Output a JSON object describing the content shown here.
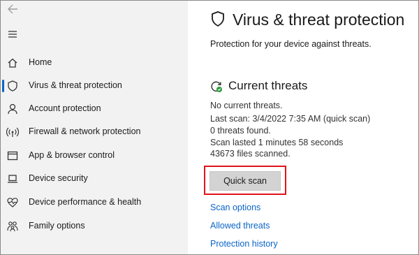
{
  "sidebar": {
    "items": [
      {
        "label": "Home",
        "icon": "home-icon"
      },
      {
        "label": "Virus & threat protection",
        "icon": "shield-icon",
        "active": true
      },
      {
        "label": "Account protection",
        "icon": "person-icon"
      },
      {
        "label": "Firewall & network protection",
        "icon": "wifi-icon"
      },
      {
        "label": "App & browser control",
        "icon": "app-window-icon"
      },
      {
        "label": "Device security",
        "icon": "laptop-icon"
      },
      {
        "label": "Device performance & health",
        "icon": "heart-icon"
      },
      {
        "label": "Family options",
        "icon": "family-icon"
      }
    ]
  },
  "main": {
    "title": "Virus & threat protection",
    "subtitle": "Protection for your device against threats.",
    "current_threats": {
      "heading": "Current threats",
      "status": "No current threats.",
      "last_scan": "Last scan: 3/4/2022 7:35 AM (quick scan)",
      "threats_found": "0 threats found.",
      "scan_duration": "Scan lasted 1 minutes 58 seconds",
      "files_scanned": "43673 files scanned."
    },
    "quick_scan_label": "Quick scan",
    "links": {
      "scan_options": "Scan options",
      "allowed_threats": "Allowed threats",
      "protection_history": "Protection history"
    }
  },
  "colors": {
    "accent": "#0a64c8",
    "highlight_box": "#e0131a",
    "ok_green": "#2e9b3a",
    "sidebar_bg": "#f2f2f2"
  }
}
